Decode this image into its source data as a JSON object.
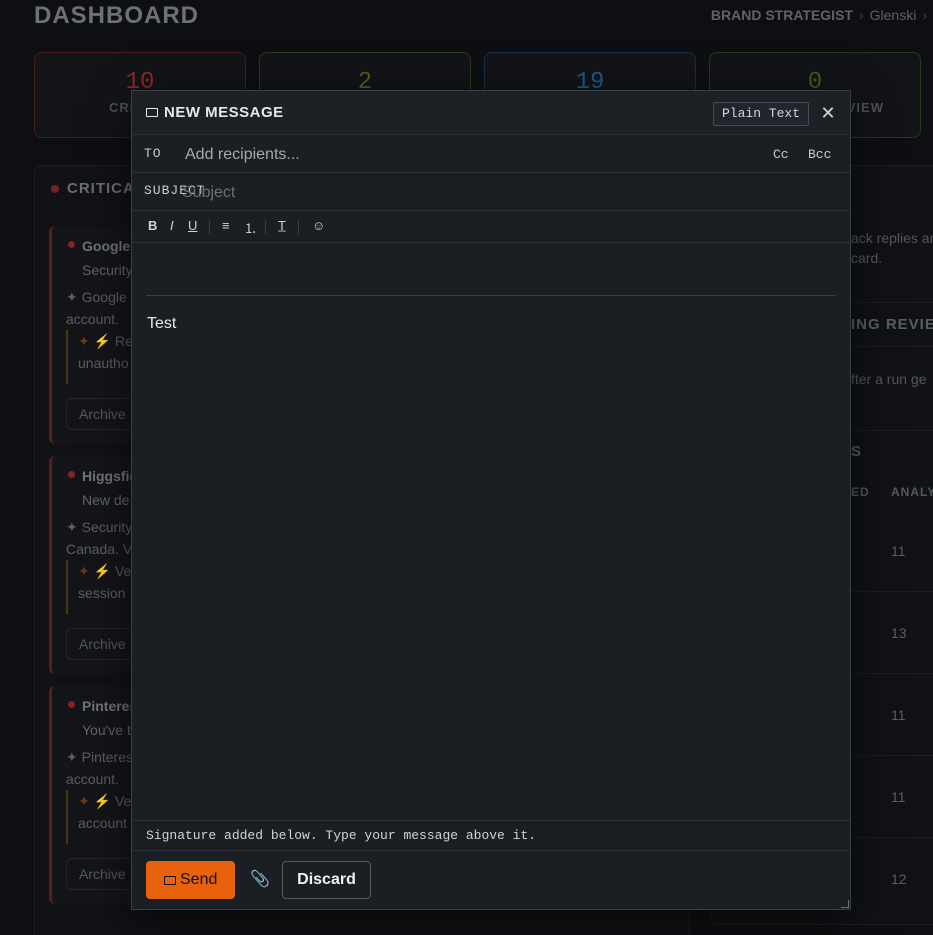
{
  "dashboard": {
    "title": "DASHBOARD",
    "breadcrumb": {
      "role": "BRAND STRATEGIST",
      "user": "Glenski",
      "sep": "›"
    },
    "stats": [
      {
        "value": "10",
        "label": "CRI",
        "color": "#8a2a2a"
      },
      {
        "value": "2",
        "label": "",
        "color": "#4d5e22"
      },
      {
        "value": "19",
        "label": "",
        "color": "#1f5a8c"
      },
      {
        "value": "0",
        "label": "VIEW",
        "color": "#4a5a22"
      }
    ],
    "critical_panel": {
      "heading": "CRITICA",
      "alerts": [
        {
          "title": "Google",
          "subtitle": "Security",
          "body": "✦ Google",
          "body2": "account.",
          "quote1": "Re",
          "quote2": "unautho",
          "button": "Archive"
        },
        {
          "title": "Higgsfie",
          "subtitle": "New de",
          "body": "✦ Security",
          "body2": "Canada. V",
          "quote1": "Ve",
          "quote2": "session",
          "button": "Archive"
        },
        {
          "title": "Pinteres",
          "subtitle": "You've t",
          "body": "✦ Pinteres",
          "body2": "account.",
          "quote1": "Ve",
          "quote2": "account",
          "button": "Archive"
        }
      ]
    },
    "right_panel": {
      "text1": "ack replies an",
      "text2": "card.",
      "heading2": "ING REVIE",
      "text3": "fter a run ge",
      "heading3": "S",
      "col1": "ED",
      "col2": "ANALY",
      "values": [
        "11",
        "13",
        "11",
        "11",
        "12"
      ]
    }
  },
  "modal": {
    "title": "NEW MESSAGE",
    "mode_button": "Plain Text",
    "close": "✕",
    "to_label": "TO",
    "to_placeholder": "Add recipients...",
    "cc": "Cc",
    "bcc": "Bcc",
    "subject_label": "SUBJECT",
    "subject_placeholder": "Subject",
    "toolbar": {
      "bold": "B",
      "italic": "I",
      "underline": "U",
      "bullets": "≡",
      "numbered": "⒈",
      "clear": "T̲",
      "emoji": "☺"
    },
    "body": "Test",
    "signature_notice": "Signature added below. Type your message above it.",
    "send": "Send",
    "attach": "📎",
    "discard": "Discard"
  }
}
